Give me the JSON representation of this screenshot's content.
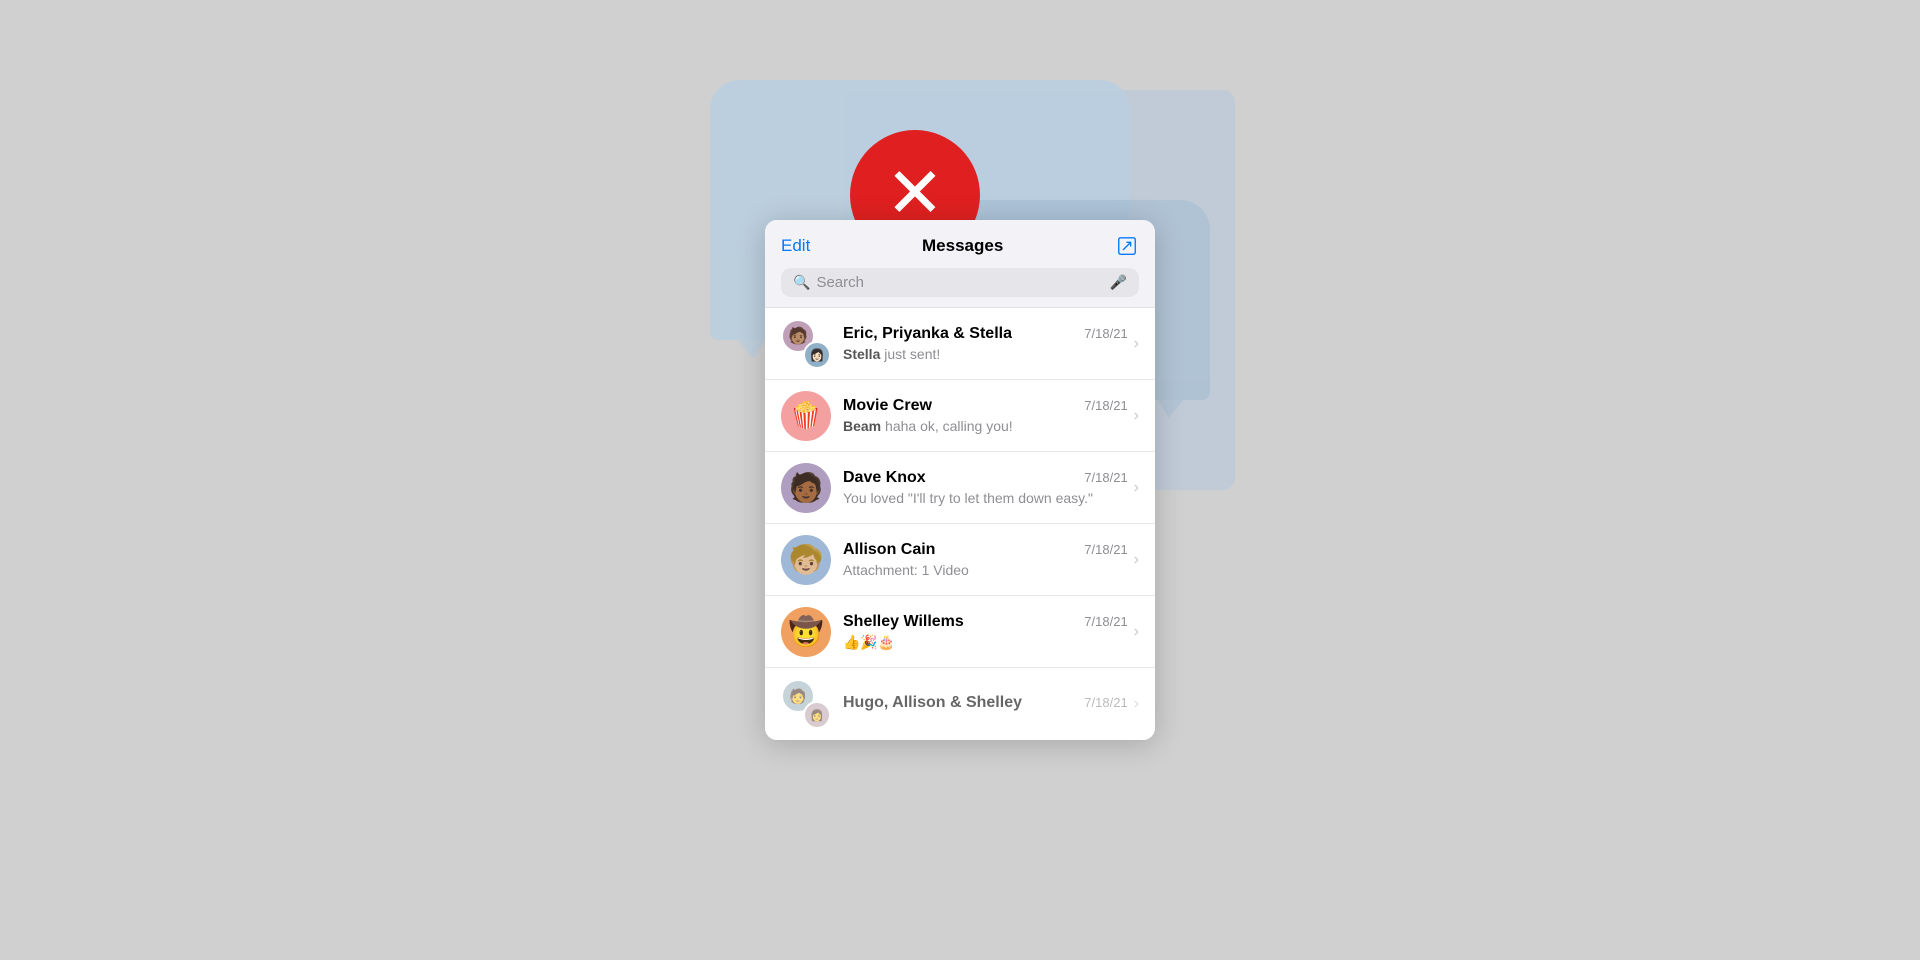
{
  "header": {
    "edit_label": "Edit",
    "title": "Messages",
    "compose_label": "Compose"
  },
  "search": {
    "placeholder": "Search"
  },
  "conversations": [
    {
      "id": "eric-priyanka-stella",
      "name": "Eric, Priyanka & Stella",
      "date": "7/18/21",
      "preview": "just sent!",
      "sender": "Stella",
      "avatar_type": "group",
      "emoji": "👩🏻"
    },
    {
      "id": "movie-crew",
      "name": "Movie Crew",
      "date": "7/18/21",
      "preview": "haha ok, calling you!",
      "sender": "Beam",
      "avatar_type": "emoji",
      "emoji": "🍿"
    },
    {
      "id": "dave-knox",
      "name": "Dave Knox",
      "date": "7/18/21",
      "preview": "You loved \"I'll try to let them down easy.\"",
      "sender": "",
      "avatar_type": "emoji",
      "emoji": "🧑🏾"
    },
    {
      "id": "allison-cain",
      "name": "Allison Cain",
      "date": "7/18/21",
      "preview": "Attachment: 1 Video",
      "sender": "",
      "avatar_type": "emoji",
      "emoji": "🧒🏼"
    },
    {
      "id": "shelley-willems",
      "name": "Shelley Willems",
      "date": "7/18/21",
      "preview": "👍🎉🎂",
      "sender": "",
      "avatar_type": "emoji",
      "emoji": "🤠"
    },
    {
      "id": "hugo-allison-shelley",
      "name": "Hugo, Allison & Shelley",
      "date": "7/18/21",
      "preview": "",
      "sender": "",
      "avatar_type": "group",
      "emoji": "🧑"
    }
  ],
  "overlay": {
    "error_icon": "×"
  }
}
